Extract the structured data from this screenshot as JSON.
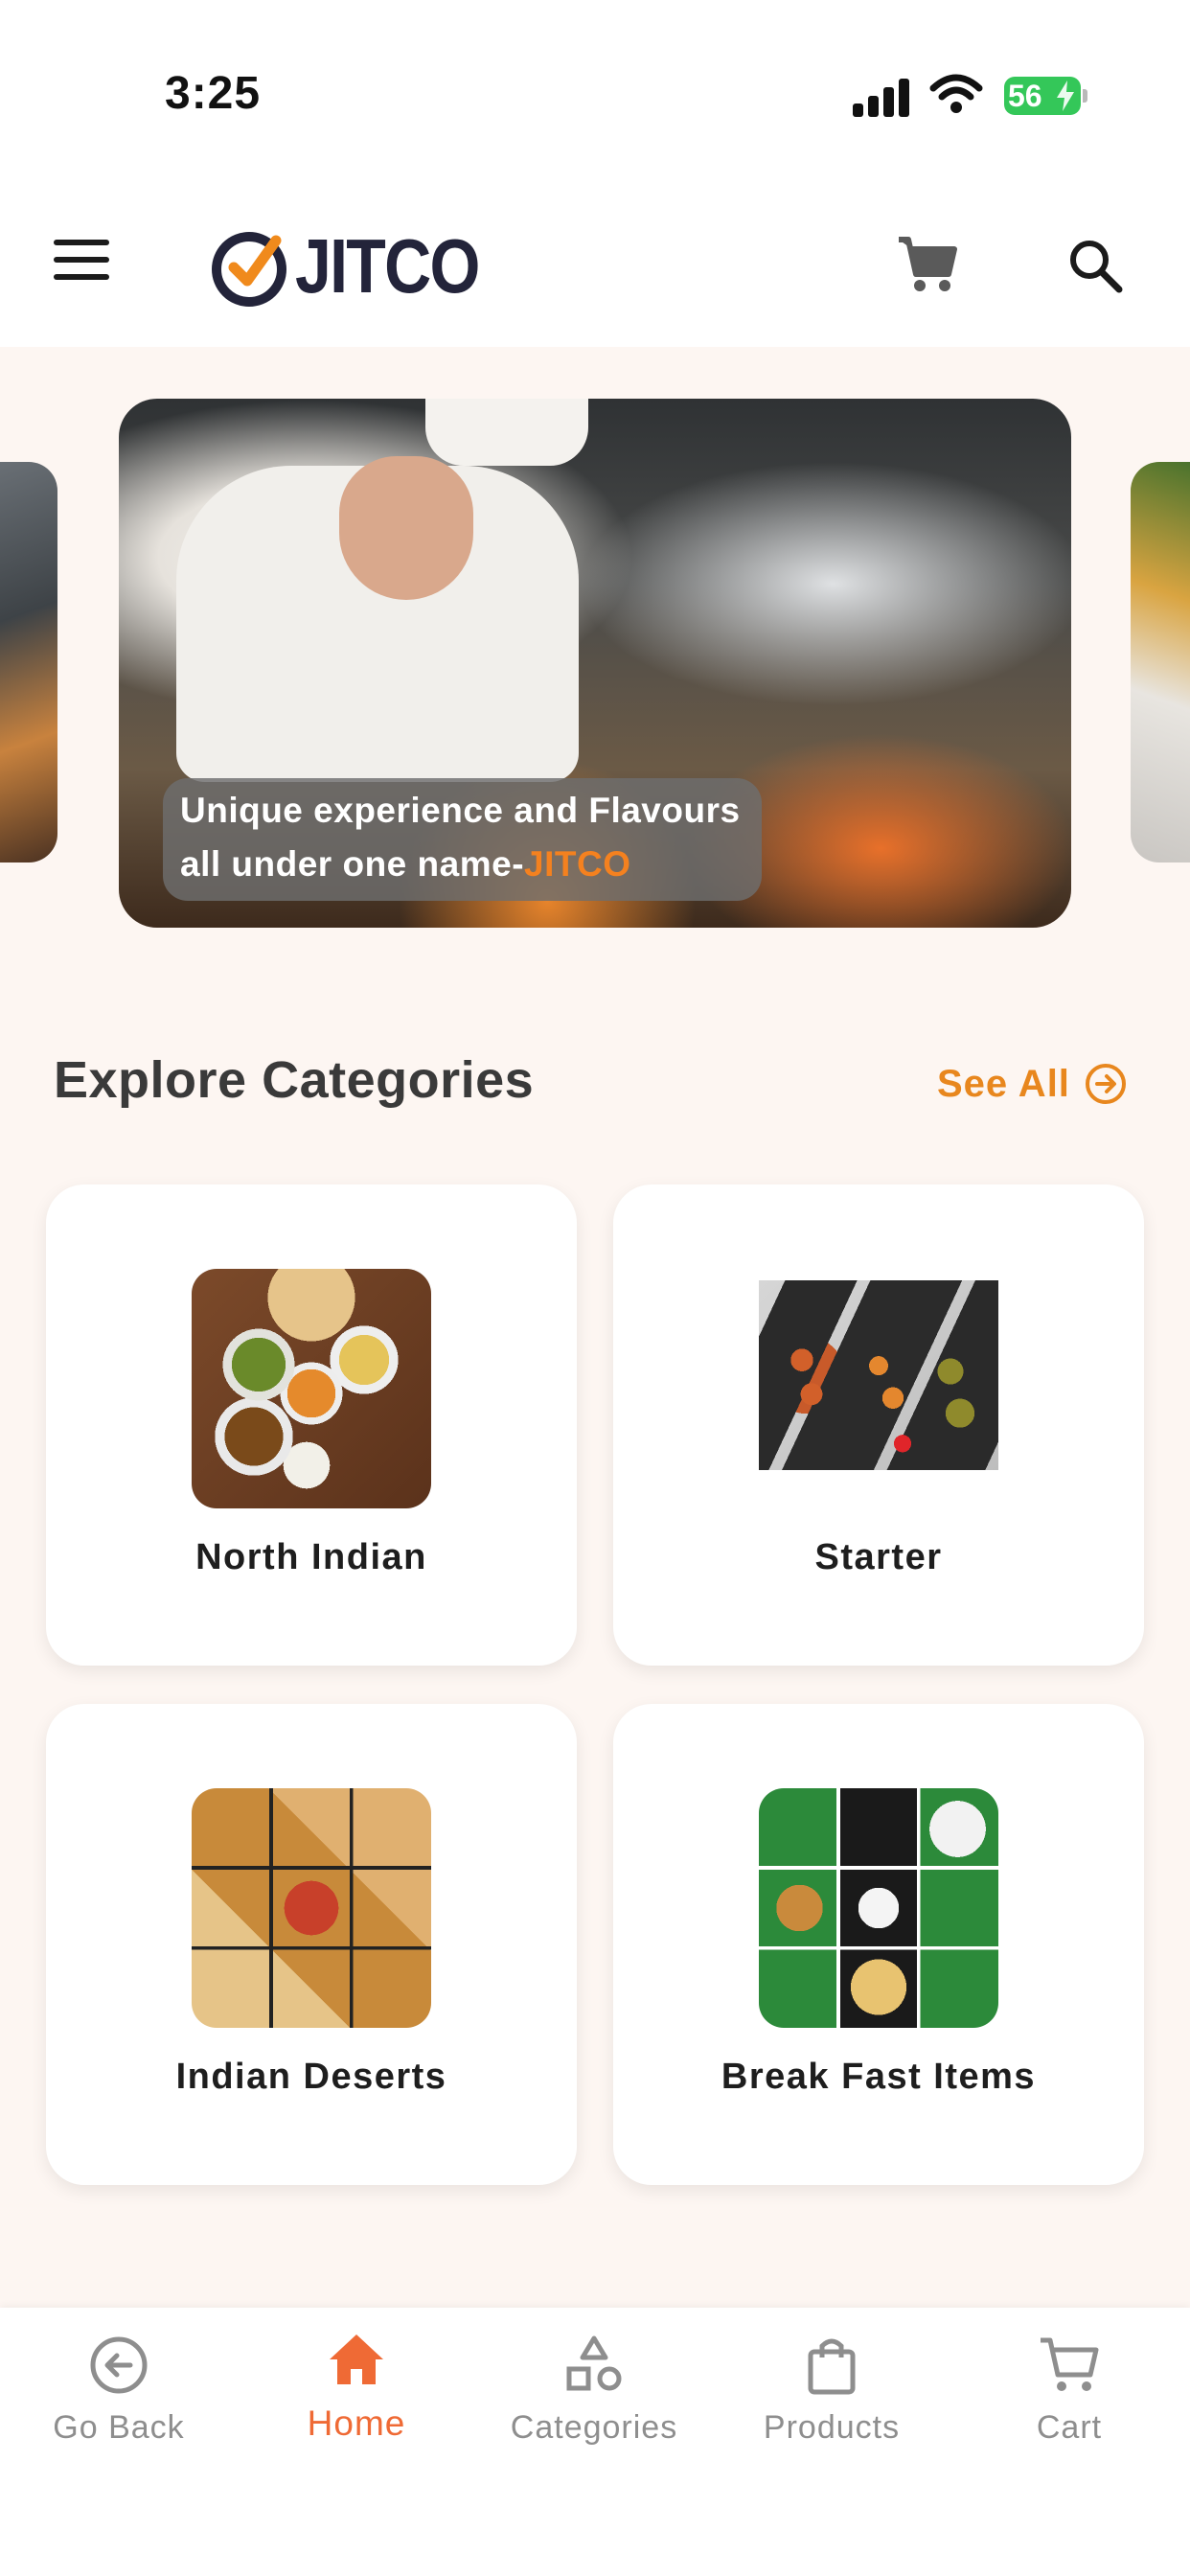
{
  "status_bar": {
    "time": "3:25",
    "battery": "56"
  },
  "header": {
    "logo_text": "JITCO",
    "icons": [
      "menu-icon",
      "cart-icon",
      "search-icon"
    ]
  },
  "banner": {
    "caption_line1": "Unique experience and Flavours",
    "caption_line2_prefix": "all under one name-",
    "caption_brand": "JITCO"
  },
  "categories_section": {
    "title": "Explore Categories",
    "see_all_label": "See All",
    "items": [
      {
        "label": "North Indian"
      },
      {
        "label": "Starter"
      },
      {
        "label": "Indian Deserts"
      },
      {
        "label": "Break Fast Items"
      }
    ]
  },
  "bottom_nav": {
    "items": [
      {
        "label": "Go Back",
        "icon": "back-arrow-circle-icon"
      },
      {
        "label": "Home",
        "icon": "home-icon",
        "active": true
      },
      {
        "label": "Categories",
        "icon": "shapes-icon"
      },
      {
        "label": "Products",
        "icon": "shopping-bag-icon"
      },
      {
        "label": "Cart",
        "icon": "cart-icon"
      }
    ]
  },
  "colors": {
    "accent": "#ef6a35",
    "see_all": "#e8871e",
    "brand_orange": "#f4811f",
    "background": "#fdf6f2",
    "inactive": "#8e8e8e"
  }
}
